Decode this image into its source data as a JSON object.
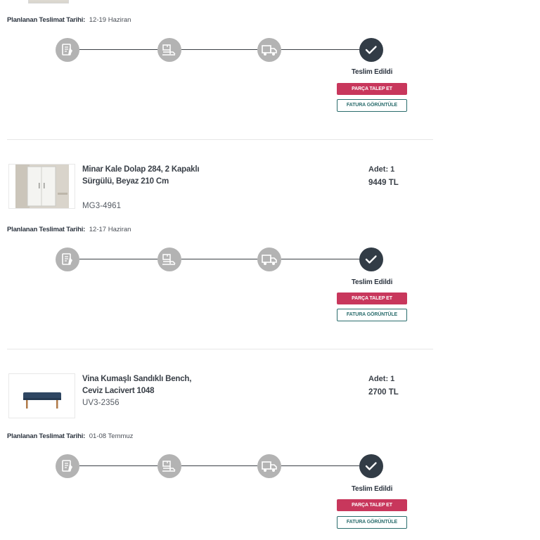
{
  "orders": [
    {
      "planned_label": "Planlanan Teslimat Tarihi:",
      "planned_date": "12-19 Haziran",
      "status": "Teslim Edildi",
      "parts_button": "PARÇA TALEP ET",
      "invoice_button": "FATURA GÖRÜNTÜLE"
    },
    {
      "product_name": "Minar Kale Dolap 284, 2 Kapaklı Sürgülü, Beyaz 210 Cm",
      "sku": "MG3-4961",
      "qty": "Adet: 1",
      "price": "9449 TL",
      "planned_label": "Planlanan Teslimat Tarihi:",
      "planned_date": "12-17 Haziran",
      "status": "Teslim Edildi",
      "parts_button": "PARÇA TALEP ET",
      "invoice_button": "FATURA GÖRÜNTÜLE"
    },
    {
      "product_name": "Vina Kumaşlı Sandıklı Bench, Ceviz Lacivert 1048",
      "sku": "UV3-2356",
      "qty": "Adet: 1",
      "price": "2700 TL",
      "planned_label": "Planlanan Teslimat Tarihi:",
      "planned_date": "01-08 Temmuz",
      "status": "Teslim Edildi",
      "parts_button": "PARÇA TALEP ET",
      "invoice_button": "FATURA GÖRÜNTÜLE"
    }
  ],
  "tracker_steps": [
    "order-received-icon",
    "preparing-icon",
    "shipping-truck-icon",
    "delivered-check-icon"
  ],
  "colors": {
    "step_inactive": "#b3b3b3",
    "step_done": "#323c46",
    "parts_button": "#c8375c",
    "invoice_button": "#2b6d6d"
  }
}
